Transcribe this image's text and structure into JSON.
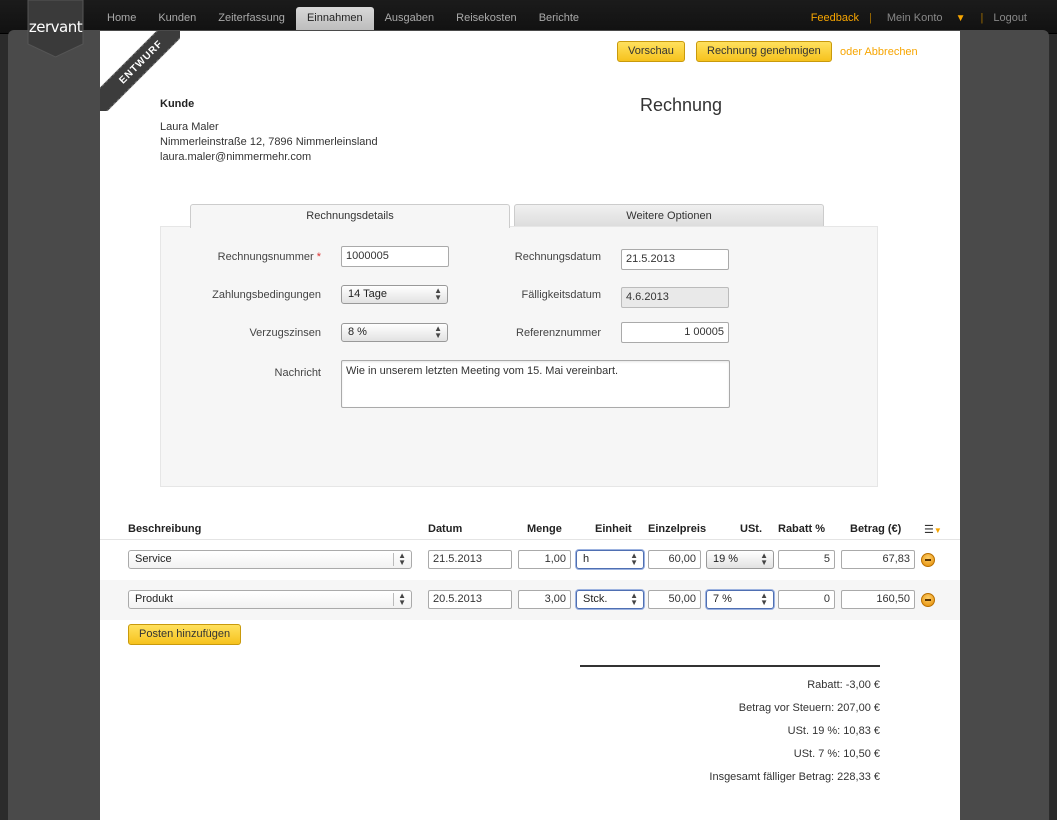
{
  "brand": {
    "logo_text": "zervant"
  },
  "nav": {
    "items": [
      "Home",
      "Kunden",
      "Zeiterfassung",
      "Einnahmen",
      "Ausgaben",
      "Reisekosten",
      "Berichte"
    ],
    "active_index": 3
  },
  "top_right": {
    "feedback": "Feedback",
    "my_account": "Mein Konto",
    "logout": "Logout"
  },
  "ribbon": {
    "label": "ENTWURF"
  },
  "actions": {
    "preview": "Vorschau",
    "approve": "Rechnung genehmigen",
    "cancel": "oder Abbrechen"
  },
  "customer": {
    "heading": "Kunde",
    "name": "Laura Maler",
    "address": "Nimmerleinstraße 12, 7896 Nimmerleinsland",
    "email": "laura.maler@nimmermehr.com"
  },
  "document": {
    "title": "Rechnung"
  },
  "tabs": [
    {
      "label": "Rechnungsdetails",
      "active": true
    },
    {
      "label": "Weitere Optionen",
      "active": false
    }
  ],
  "details": {
    "invoice_number": {
      "label": "Rechnungsnummer",
      "required_mark": "*",
      "value": "1000005"
    },
    "payment_terms": {
      "label": "Zahlungsbedingungen",
      "value": "14 Tage"
    },
    "late_interest": {
      "label": "Verzugszinsen",
      "value": "8 %"
    },
    "message": {
      "label": "Nachricht",
      "value": "Wie in unserem letzten Meeting vom 15. Mai vereinbart."
    },
    "invoice_date": {
      "label": "Rechnungsdatum",
      "value": "21.5.2013"
    },
    "due_date": {
      "label": "Fälligkeitsdatum",
      "value": "4.6.2013"
    },
    "reference": {
      "label": "Referenznummer",
      "value": "1 00005"
    }
  },
  "items_table": {
    "headers": {
      "description": "Beschreibung",
      "date": "Datum",
      "quantity": "Menge",
      "unit": "Einheit",
      "unit_price": "Einzelpreis",
      "vat": "USt.",
      "discount": "Rabatt %",
      "amount": "Betrag (€)"
    },
    "rows": [
      {
        "description": "Service",
        "date": "21.5.2013",
        "quantity": "1,00",
        "unit": "h",
        "unit_price": "60,00",
        "vat": "19 %",
        "discount": "5",
        "amount": "67,83"
      },
      {
        "description": "Produkt",
        "date": "20.5.2013",
        "quantity": "3,00",
        "unit": "Stck.",
        "unit_price": "50,00",
        "vat": "7 %",
        "discount": "0",
        "amount": "160,50"
      }
    ],
    "add_button": "Posten hinzufügen"
  },
  "totals": {
    "discount": "Rabatt: -3,00 €",
    "before_tax": "Betrag vor Steuern: 207,00 €",
    "vat19": "USt. 19 %: 10,83 €",
    "vat7": "USt. 7 %: 10,50 €",
    "total_due": "Insgesamt fälliger Betrag: 228,33 €"
  },
  "colors": {
    "accent": "#f7a500",
    "button": "#f6c21d"
  }
}
